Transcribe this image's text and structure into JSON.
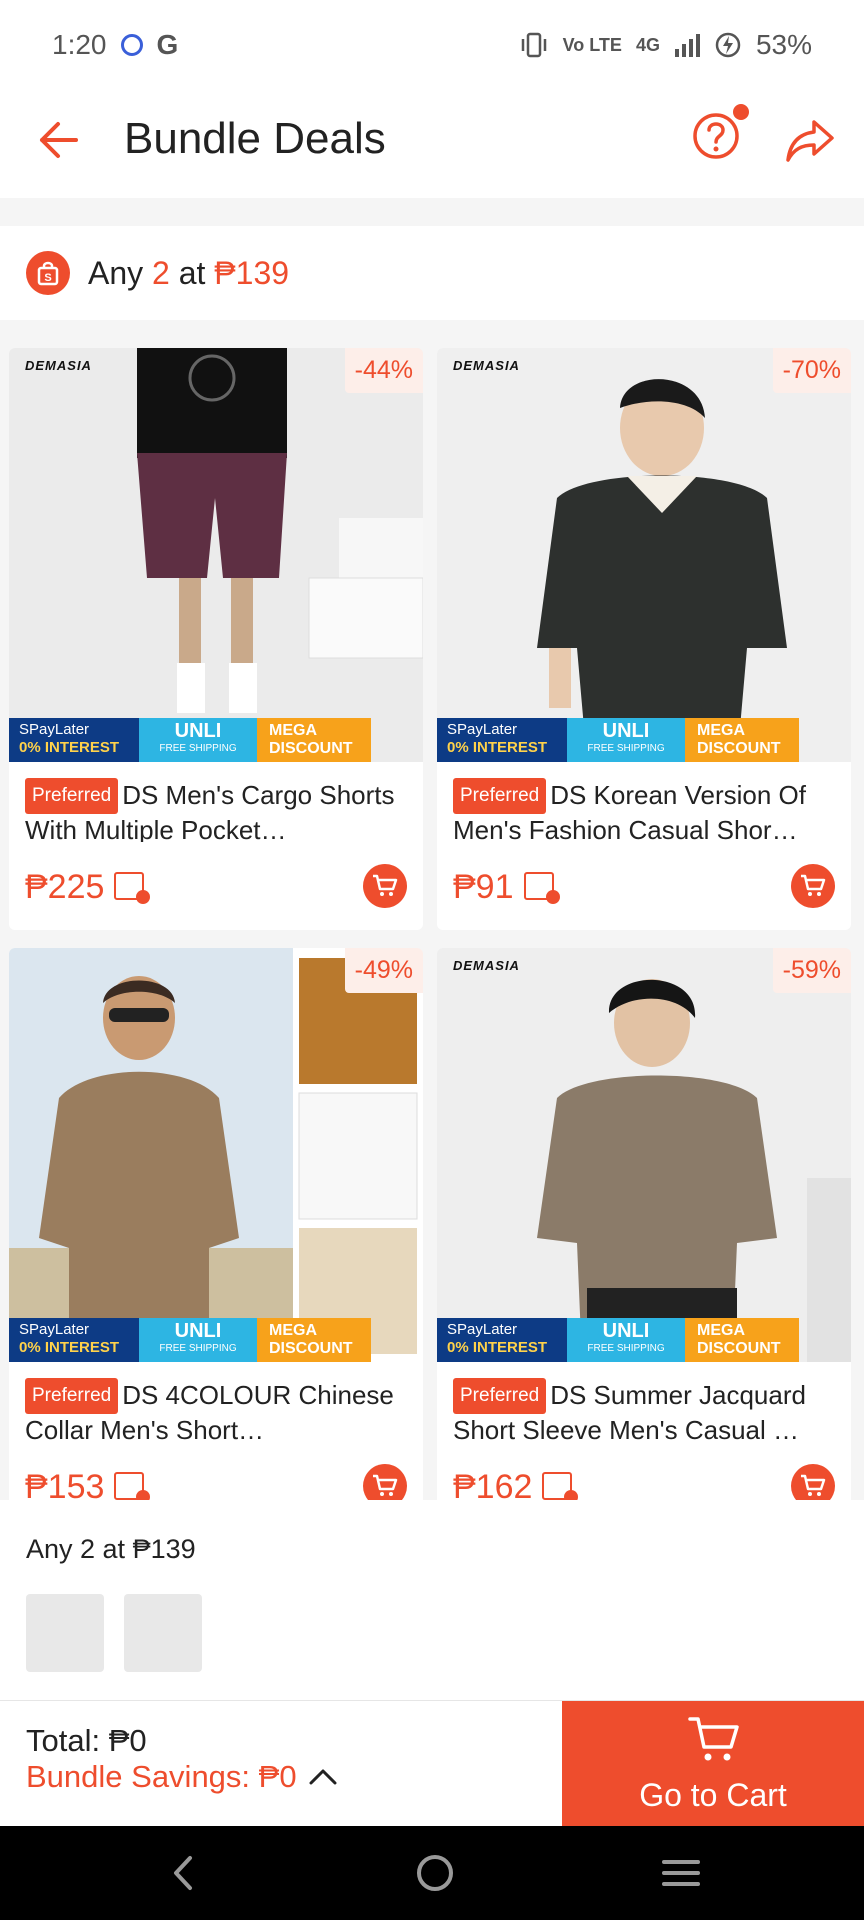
{
  "status_bar": {
    "time": "1:20",
    "g": "G",
    "net": "4G",
    "volte": "Vo LTE",
    "battery": "53%"
  },
  "header": {
    "title": "Bundle Deals"
  },
  "offer": {
    "prefix": "Any",
    "qty": "2",
    "mid": "at",
    "price": "₱139"
  },
  "promo": {
    "spaylater": "SPayLater",
    "interest": "0% INTEREST",
    "unli": "UNLI",
    "free_shipping": "FREE SHIPPING",
    "mega": "MEGA",
    "discount": "DISCOUNT"
  },
  "brand": "DEMASIA",
  "products": [
    {
      "discount": "-44%",
      "badge": "Preferred",
      "name": "DS Men's Cargo Shorts With Multiple Pocket…",
      "price": "₱225"
    },
    {
      "discount": "-70%",
      "badge": "Preferred",
      "name": "DS Korean Version Of Men's Fashion Casual Shor…",
      "price": "₱91"
    },
    {
      "discount": "-49%",
      "badge": "Preferred",
      "name": "DS 4COLOUR Chinese Collar Men's Short…",
      "price": "₱153"
    },
    {
      "discount": "-59%",
      "badge": "Preferred",
      "name": "DS Summer Jacquard Short Sleeve Men's Casual …",
      "price": "₱162"
    }
  ],
  "bundle": {
    "title": "Any 2 at ₱139"
  },
  "footer": {
    "total": "Total: ₱0",
    "savings": "Bundle Savings: ₱0",
    "cta": "Go to Cart"
  },
  "colors": {
    "accent": "#ee4d2d"
  }
}
